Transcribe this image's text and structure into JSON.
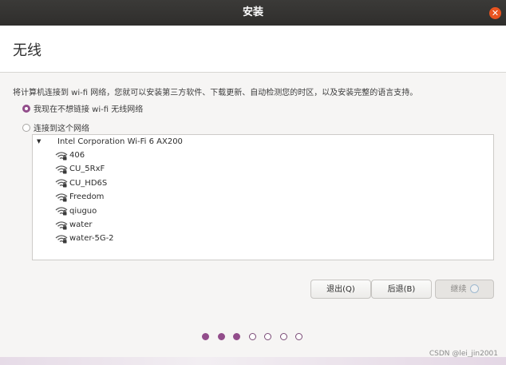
{
  "window": {
    "title": "安装"
  },
  "page": {
    "title": "无线",
    "description": "将计算机连接到 wi-fi 网络，您就可以安装第三方软件、下载更新、自动检测您的时区，以及安装完整的语言支持。"
  },
  "options": {
    "no_connect": {
      "label": "我现在不想链接 wi-fi 无线网络",
      "checked": true
    },
    "connect": {
      "label": "连接到这个网络",
      "checked": false
    }
  },
  "network_list": {
    "adapter": "Intel Corporation Wi-Fi 6 AX200",
    "networks": [
      {
        "ssid": "406"
      },
      {
        "ssid": "CU_5RxF"
      },
      {
        "ssid": "CU_HD6S"
      },
      {
        "ssid": "Freedom"
      },
      {
        "ssid": "qiuguo"
      },
      {
        "ssid": "water"
      },
      {
        "ssid": "water-5G-2"
      }
    ]
  },
  "buttons": {
    "quit": "退出(Q)",
    "back": "后退(B)",
    "continue": "继续"
  },
  "progress": {
    "total_steps": 7,
    "completed_steps": 3
  },
  "watermark": "CSDN @lei_jin2001",
  "colors": {
    "accent": "#924d8b",
    "titlebar": "#2f2e2c",
    "close": "#e95420"
  }
}
